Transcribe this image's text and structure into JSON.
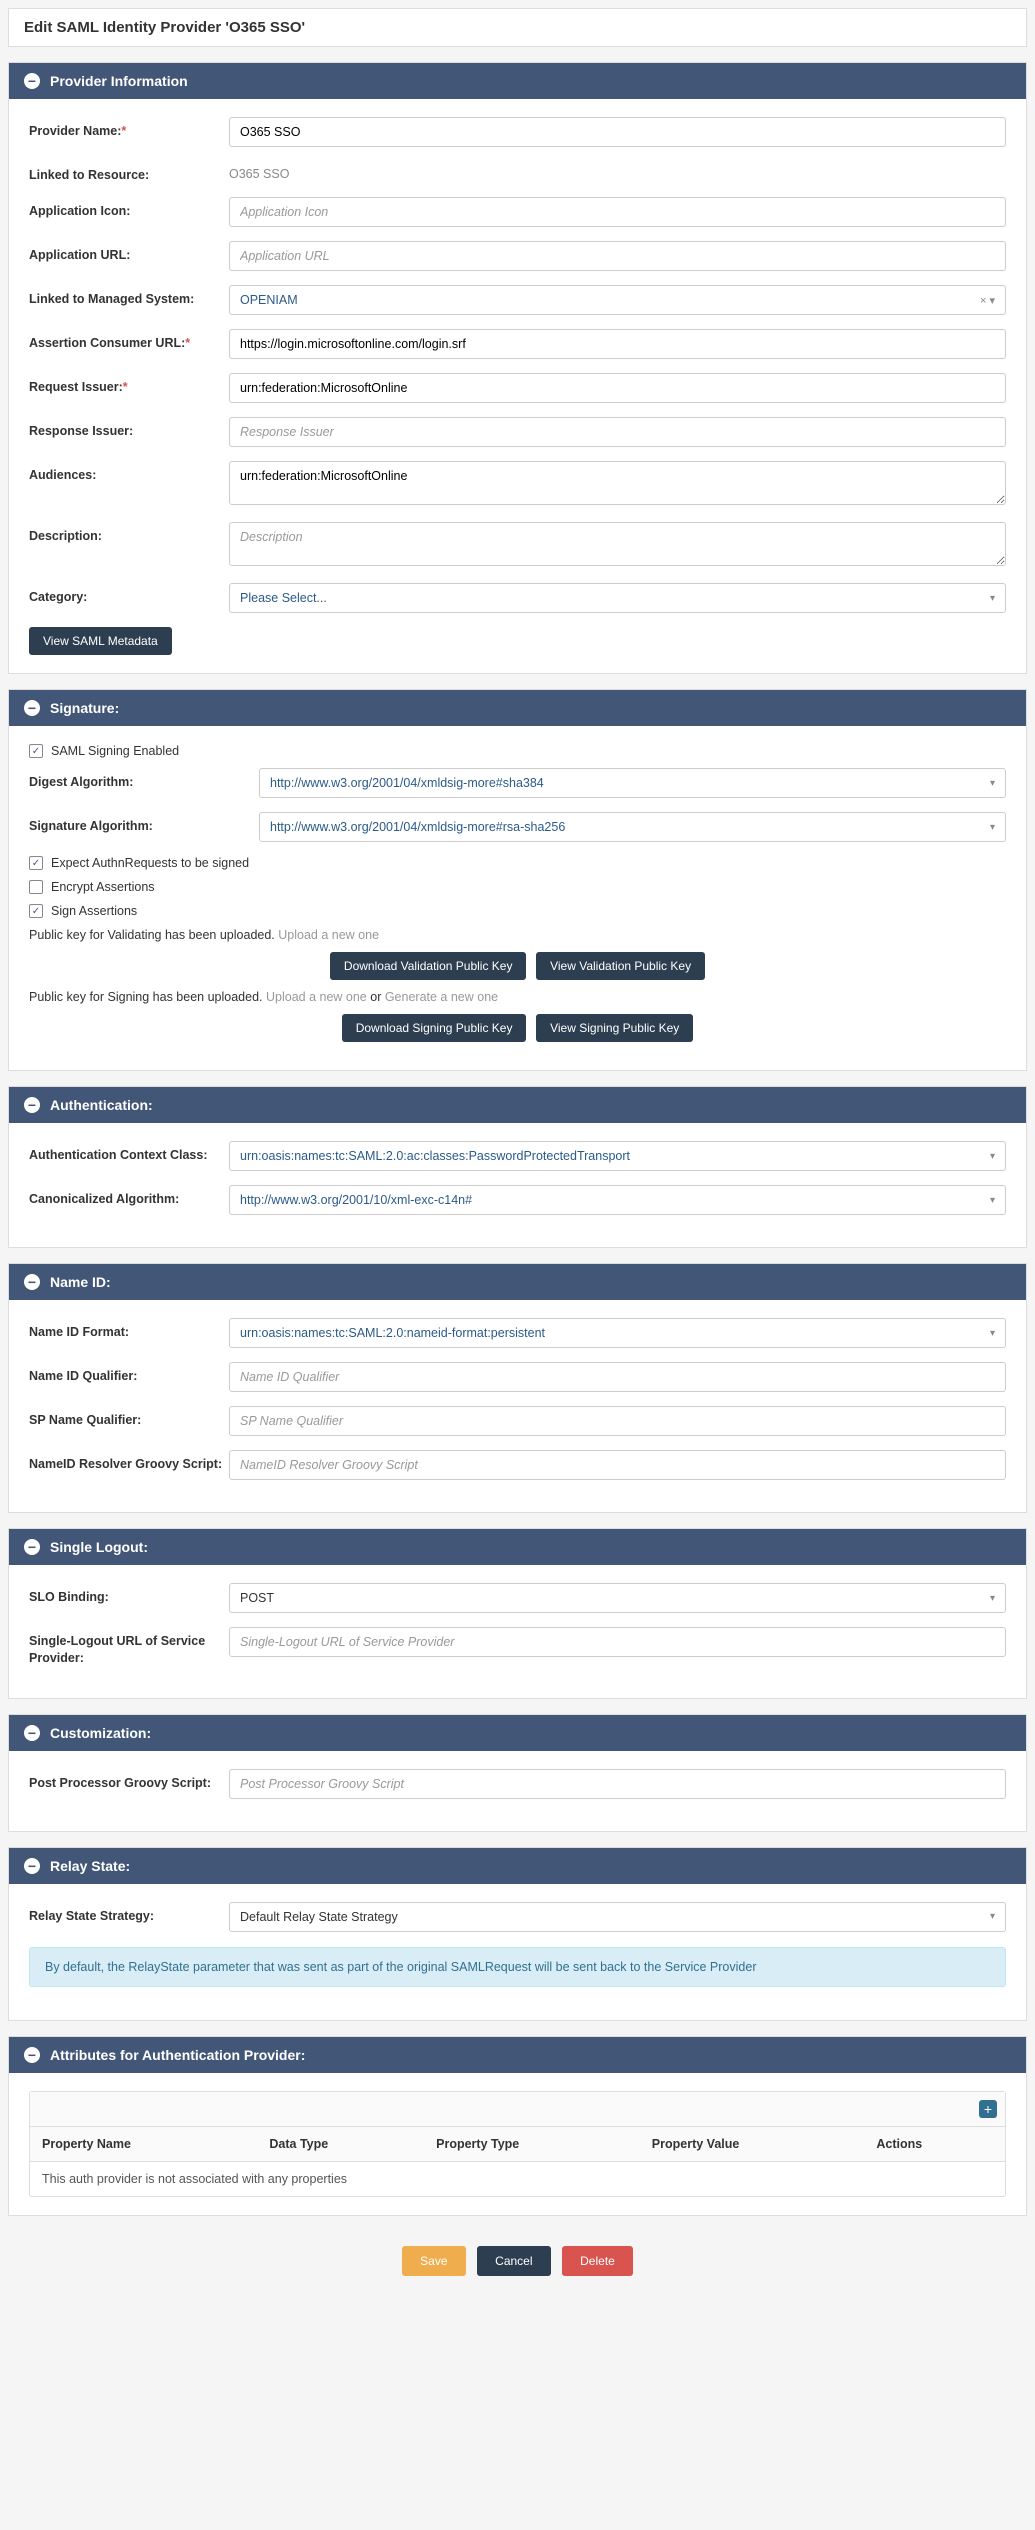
{
  "pageTitle": "Edit SAML Identity Provider 'O365 SSO'",
  "providerInfo": {
    "header": "Provider Information",
    "providerNameLabel": "Provider Name:",
    "providerNameValue": "O365 SSO",
    "linkedResourceLabel": "Linked to Resource:",
    "linkedResourceValue": "O365 SSO",
    "appIconLabel": "Application Icon:",
    "appIconPlaceholder": "Application Icon",
    "appUrlLabel": "Application URL:",
    "appUrlPlaceholder": "Application URL",
    "managedSystemLabel": "Linked to Managed System:",
    "managedSystemValue": "OPENIAM",
    "acsUrlLabel": "Assertion Consumer URL:",
    "acsUrlValue": "https://login.microsoftonline.com/login.srf",
    "reqIssuerLabel": "Request Issuer:",
    "reqIssuerValue": "urn:federation:MicrosoftOnline",
    "respIssuerLabel": "Response Issuer:",
    "respIssuerPlaceholder": "Response Issuer",
    "audiencesLabel": "Audiences:",
    "audiencesValue": "urn:federation:MicrosoftOnline",
    "descriptionLabel": "Description:",
    "descriptionPlaceholder": "Description",
    "categoryLabel": "Category:",
    "categoryValue": "Please Select...",
    "viewMetadataBtn": "View SAML Metadata"
  },
  "signature": {
    "header": "Signature:",
    "signingEnabledLabel": "SAML Signing Enabled",
    "digestAlgLabel": "Digest Algorithm:",
    "digestAlgValue": "http://www.w3.org/2001/04/xmldsig-more#sha384",
    "sigAlgLabel": "Signature Algorithm:",
    "sigAlgValue": "http://www.w3.org/2001/04/xmldsig-more#rsa-sha256",
    "expectSignedLabel": "Expect AuthnRequests to be signed",
    "encryptAssertionsLabel": "Encrypt Assertions",
    "signAssertionsLabel": "Sign Assertions",
    "validatingUploadText": "Public key for Validating has been uploaded. ",
    "uploadNewLink": "Upload a new one",
    "downloadValidationBtn": "Download Validation Public Key",
    "viewValidationBtn": "View Validation Public Key",
    "signingUploadText": "Public key for Signing has been uploaded. ",
    "orText": " or ",
    "generateNewLink": "Generate a new one",
    "downloadSigningBtn": "Download Signing Public Key",
    "viewSigningBtn": "View Signing Public Key"
  },
  "authentication": {
    "header": "Authentication:",
    "contextClassLabel": "Authentication Context Class:",
    "contextClassValue": "urn:oasis:names:tc:SAML:2.0:ac:classes:PasswordProtectedTransport",
    "canonAlgLabel": "Canonicalized Algorithm:",
    "canonAlgValue": "http://www.w3.org/2001/10/xml-exc-c14n#"
  },
  "nameId": {
    "header": "Name ID:",
    "formatLabel": "Name ID Format:",
    "formatValue": "urn:oasis:names:tc:SAML:2.0:nameid-format:persistent",
    "qualifierLabel": "Name ID Qualifier:",
    "qualifierPlaceholder": "Name ID Qualifier",
    "spQualifierLabel": "SP Name Qualifier:",
    "spQualifierPlaceholder": "SP Name Qualifier",
    "resolverLabel": "NameID Resolver Groovy Script:",
    "resolverPlaceholder": "NameID Resolver Groovy Script"
  },
  "slo": {
    "header": "Single Logout:",
    "bindingLabel": "SLO Binding:",
    "bindingValue": "POST",
    "urlLabel": "Single-Logout URL of Service Provider:",
    "urlPlaceholder": "Single-Logout URL of Service Provider"
  },
  "customization": {
    "header": "Customization:",
    "postProcLabel": "Post Processor Groovy Script:",
    "postProcPlaceholder": "Post Processor Groovy Script"
  },
  "relayState": {
    "header": "Relay State:",
    "strategyLabel": "Relay State Strategy:",
    "strategyValue": "Default Relay State Strategy",
    "infoText": "By default, the RelayState parameter that was sent as part of the original SAMLRequest will be sent back to the Service Provider"
  },
  "attributes": {
    "header": "Attributes for Authentication Provider:",
    "colPropertyName": "Property Name",
    "colDataType": "Data Type",
    "colPropertyType": "Property Type",
    "colPropertyValue": "Property Value",
    "colActions": "Actions",
    "emptyText": "This auth provider is not associated with any properties"
  },
  "footer": {
    "save": "Save",
    "cancel": "Cancel",
    "delete": "Delete"
  }
}
